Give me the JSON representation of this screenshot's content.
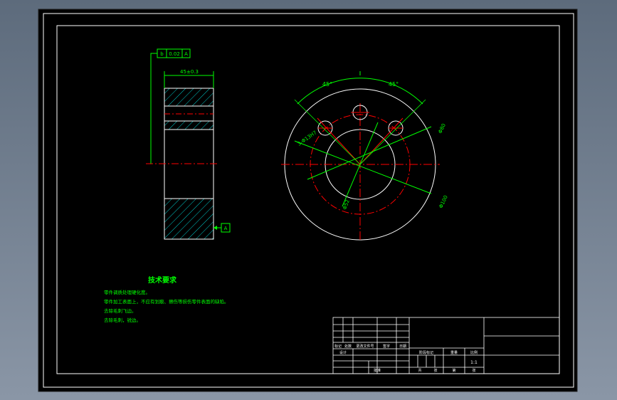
{
  "drawing": {
    "title_requirements": "技术要求",
    "requirements": [
      "零件调质处理硬化度。",
      "零件加工表面上，不应有划痕、擦伤等损伤零件表面的缺陷。",
      "去除毛刺飞边。",
      "去除毛刺，锐边。"
    ],
    "gdt_datum_letter": "b",
    "gdt_tolerance": "0.02",
    "gdt_datum_ref": "A",
    "datum_label": "A",
    "width_dim": "45±0.3",
    "angle_left": "45°",
    "angle_right": "45°",
    "hole_callout": "3-Φ13H7",
    "outer_dia": "Φ100",
    "pcd": "Φ80",
    "inner_dia": "Φ52"
  },
  "title_block": {
    "row_labels": [
      "标记",
      "处数",
      "更改文件号",
      "签字",
      "日期"
    ],
    "designer_label": "设计",
    "stage_labels": [
      "阶段标记",
      "重量",
      "比例"
    ],
    "scale": "1:1",
    "bottom_labels": [
      "共",
      "张",
      "第",
      "张"
    ],
    "approve_label": "批准"
  },
  "colors": {
    "background": "#000000",
    "frame": "#ffffff",
    "dimension": "#00ff00",
    "centerline": "#ff0000",
    "hatch": "#00c8c8"
  }
}
